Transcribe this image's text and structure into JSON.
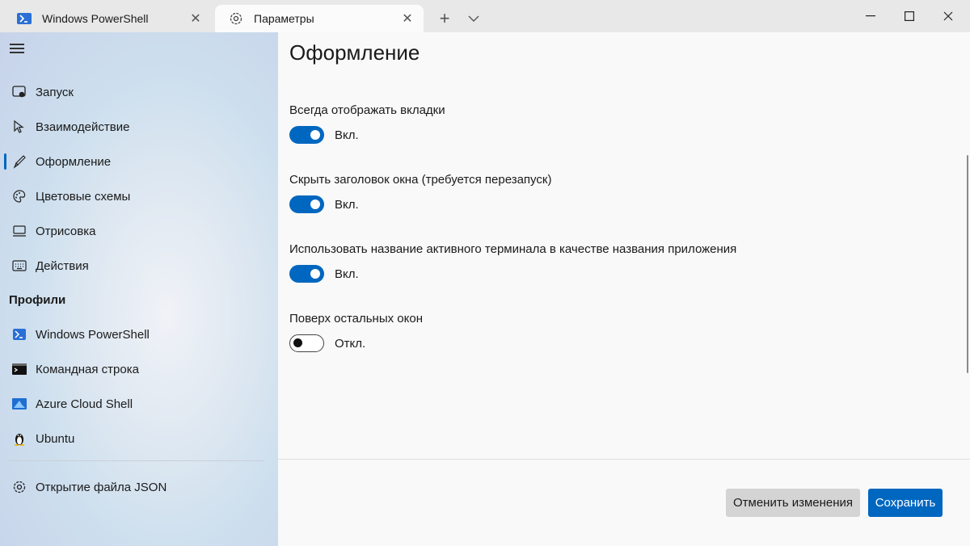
{
  "tabs": [
    {
      "label": "Windows PowerShell",
      "icon": "powershell-icon"
    },
    {
      "label": "Параметры",
      "icon": "gear-icon"
    }
  ],
  "window_controls": {
    "minimize": "minimize-icon",
    "maximize": "maximize-icon",
    "close": "close-icon"
  },
  "sidebar": {
    "items": [
      {
        "label": "Запуск",
        "icon": "startup-icon"
      },
      {
        "label": "Взаимодействие",
        "icon": "interaction-icon"
      },
      {
        "label": "Оформление",
        "icon": "brush-icon",
        "selected": true
      },
      {
        "label": "Цветовые схемы",
        "icon": "palette-icon"
      },
      {
        "label": "Отрисовка",
        "icon": "monitor-icon"
      },
      {
        "label": "Действия",
        "icon": "keyboard-icon"
      }
    ],
    "profiles_header": "Профили",
    "profiles": [
      {
        "label": "Windows PowerShell",
        "icon": "powershell-icon"
      },
      {
        "label": "Командная строка",
        "icon": "cmd-icon"
      },
      {
        "label": "Azure Cloud Shell",
        "icon": "azure-icon"
      },
      {
        "label": "Ubuntu",
        "icon": "linux-penguin-icon"
      }
    ],
    "open_json": {
      "label": "Открытие файла JSON",
      "icon": "gear-icon"
    }
  },
  "content": {
    "title": "Оформление",
    "settings": [
      {
        "label": "Всегда отображать вкладки",
        "state": "Вкл.",
        "on": true
      },
      {
        "label": "Скрыть заголовок окна (требуется перезапуск)",
        "state": "Вкл.",
        "on": true
      },
      {
        "label": "Использовать название активного терминала в качестве названия приложения",
        "state": "Вкл.",
        "on": true
      },
      {
        "label": "Поверх остальных окон",
        "state": "Откл.",
        "on": false
      }
    ]
  },
  "footer": {
    "discard_label": "Отменить изменения",
    "save_label": "Сохранить"
  },
  "colors": {
    "accent": "#0067c0"
  }
}
